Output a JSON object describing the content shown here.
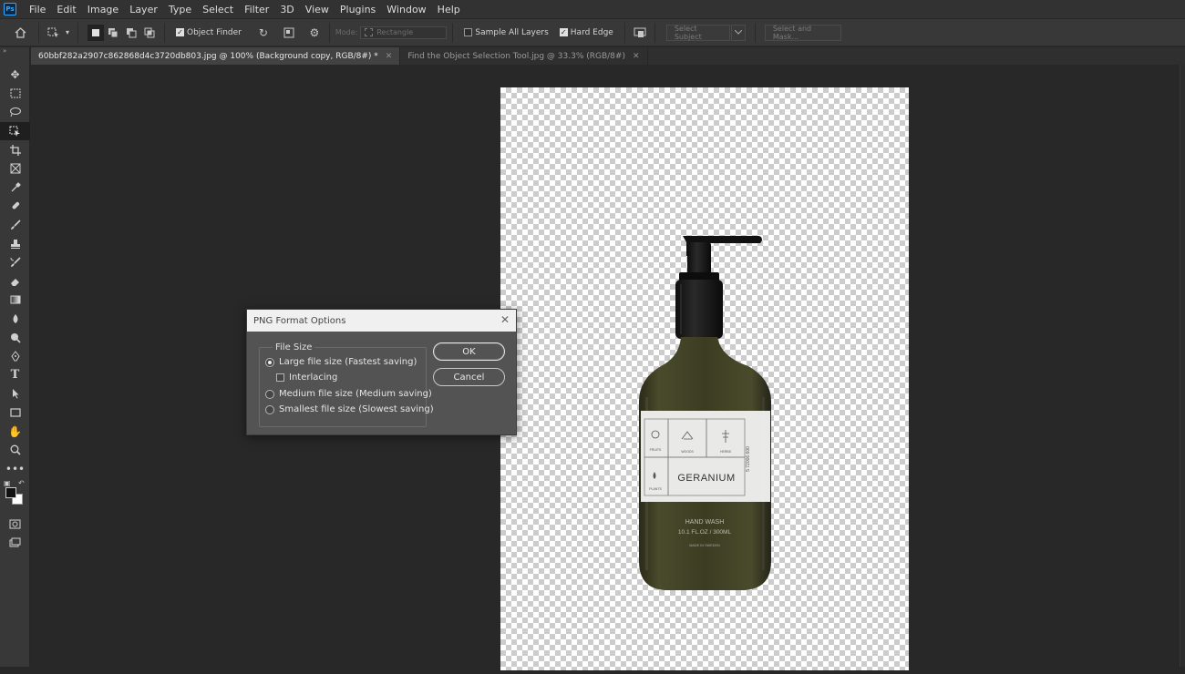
{
  "app": {
    "logo": "Ps"
  },
  "menu": [
    "File",
    "Edit",
    "Image",
    "Layer",
    "Type",
    "Select",
    "Filter",
    "3D",
    "View",
    "Plugins",
    "Window",
    "Help"
  ],
  "options_bar": {
    "object_finder_label": "Object Finder",
    "object_finder_checked": true,
    "mode_label": "Mode:",
    "mode_value": "Rectangle",
    "sample_all_layers_label": "Sample All Layers",
    "sample_all_layers_checked": false,
    "hard_edge_label": "Hard Edge",
    "hard_edge_checked": true,
    "select_subject_label": "Select Subject",
    "select_and_mask_label": "Select and Mask..."
  },
  "tabs": [
    {
      "label": "60bbf282a2907c862868d4c3720db803.jpg @ 100% (Background copy, RGB/8#) *",
      "active": true
    },
    {
      "label": "Find the Object Selection Tool.jpg @ 33.3% (RGB/8#)",
      "active": false
    }
  ],
  "tools": [
    "move-icon",
    "marquee-icon",
    "lasso-icon",
    "object-selection-icon",
    "crop-icon",
    "frame-icon",
    "eyedropper-icon",
    "healing-brush-icon",
    "brush-icon",
    "stamp-icon",
    "history-brush-icon",
    "eraser-icon",
    "gradient-icon",
    "blur-icon",
    "dodge-icon",
    "pen-icon",
    "type-icon",
    "path-selection-icon",
    "rectangle-icon",
    "hand-icon",
    "zoom-icon",
    "more-tools-icon"
  ],
  "colors": {
    "foreground": "#111111",
    "background": "#ffffff"
  },
  "dialog": {
    "title": "PNG Format Options",
    "group_label": "File Size",
    "options": [
      {
        "label": "Large file size (Fastest saving)",
        "selected": true
      },
      {
        "label": "Medium file size (Medium saving)",
        "selected": false
      },
      {
        "label": "Smallest file size (Slowest saving)",
        "selected": false
      }
    ],
    "interlacing_label": "Interlacing",
    "interlacing_checked": false,
    "ok_label": "OK",
    "cancel_label": "Cancel"
  },
  "product": {
    "brand_name": "GERANIUM",
    "product_type": "HAND WASH",
    "volume": "10.1 FL.OZ / 300ML",
    "origin": "MADE IN SWEDEN",
    "icon_labels": [
      "FRUITS",
      "WOODS",
      "HERBS",
      "PLANTS"
    ],
    "code": "5 72006 600"
  }
}
